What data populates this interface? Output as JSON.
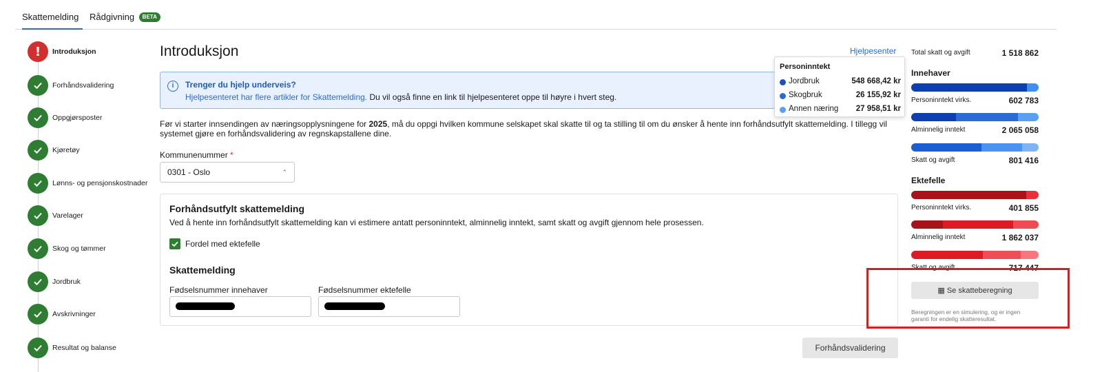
{
  "tabs": [
    {
      "label": "Skattemelding",
      "active": true
    },
    {
      "label": "Rådgivning",
      "badge": "BETA",
      "active": false
    }
  ],
  "steps": [
    {
      "label": "Introduksjon",
      "status": "error",
      "icon": "!"
    },
    {
      "label": "Forhåndsvalidering",
      "status": "done"
    },
    {
      "label": "Oppgjørsposter",
      "status": "done"
    },
    {
      "label": "Kjøretøy",
      "status": "done"
    },
    {
      "label": "Lønns- og pensjonskostnader",
      "status": "done"
    },
    {
      "label": "Varelager",
      "status": "done"
    },
    {
      "label": "Skog og tømmer",
      "status": "done"
    },
    {
      "label": "Jordbruk",
      "status": "done"
    },
    {
      "label": "Avskrivninger",
      "status": "done"
    },
    {
      "label": "Resultat og balanse",
      "status": "done"
    }
  ],
  "main": {
    "title": "Introduksjon",
    "help_link": "Hjelpesenter",
    "info": {
      "title": "Trenger du hjelp underveis?",
      "link_text": "Hjelpesenteret har flere artikler for Skattemelding.",
      "text_rest": " Du vil også finne en link til hjelpesenteret oppe til høyre i hvert steg."
    },
    "intro_pre": "Før vi starter innsendingen av næringsopplysningene for ",
    "intro_year": "2025",
    "intro_post": ", må du oppgi hvilken kommune selskapet skal skatte til og ta stilling til om du ønsker å hente inn forhåndsutfylt skattemelding. I tillegg vil systemet gjøre en forhåndsvalidering av regnskapstallene dine.",
    "kommune": {
      "label": "Kommunenummer",
      "required_mark": "*",
      "value": "0301 - Oslo"
    },
    "card": {
      "title": "Forhåndsutfylt skattemelding",
      "desc": "Ved å hente inn forhåndsutfylt skattemelding kan vi estimere antatt personinntekt, alminnelig inntekt, samt skatt og avgift gjennom hele prosessen.",
      "checkbox_label": "Fordel med ektefelle",
      "checkbox_checked": true,
      "section_title": "Skattemelding",
      "field1_label": "Fødselsnummer innehaver",
      "field2_label": "Fødselsnummer ektefelle"
    },
    "next_button": "Forhåndsvalidering"
  },
  "tooltip": {
    "title": "Personinntekt",
    "rows": [
      {
        "name": "Jordbruk",
        "value": "548 668,42 kr",
        "color": "#1c4fbf"
      },
      {
        "name": "Skogbruk",
        "value": "26 155,92 kr",
        "color": "#2a6bd6"
      },
      {
        "name": "Annen næring",
        "value": "27 958,51 kr",
        "color": "#5aa0f0"
      }
    ]
  },
  "summary": {
    "total_label": "Total skatt og avgift",
    "total_value": "1 518 862",
    "innehaver": {
      "heading": "Innehaver",
      "rows": [
        {
          "label": "Personinntekt virks.",
          "value": "602 783",
          "bar": [
            {
              "pct": 91,
              "color": "#0e3fb0"
            },
            {
              "pct": 9,
              "color": "#3f8ef0"
            }
          ]
        },
        {
          "label": "Alminnelig inntekt",
          "value": "2 065 058",
          "bar": [
            {
              "pct": 35,
              "color": "#0e3fb0"
            },
            {
              "pct": 49,
              "color": "#2a6bd6"
            },
            {
              "pct": 16,
              "color": "#5aa0f0"
            }
          ]
        },
        {
          "label": "Skatt og avgift",
          "value": "801 416",
          "bar": [
            {
              "pct": 55,
              "color": "#1c5fd1"
            },
            {
              "pct": 32,
              "color": "#4a93ee"
            },
            {
              "pct": 13,
              "color": "#7fb4f3"
            }
          ]
        }
      ]
    },
    "ektefelle": {
      "heading": "Ektefelle",
      "rows": [
        {
          "label": "Personinntekt virks.",
          "value": "401 855",
          "bar": [
            {
              "pct": 90,
              "color": "#a8131a"
            },
            {
              "pct": 10,
              "color": "#e8303a"
            }
          ]
        },
        {
          "label": "Alminnelig inntekt",
          "value": "1 862 037",
          "bar": [
            {
              "pct": 25,
              "color": "#a8131a"
            },
            {
              "pct": 55,
              "color": "#e01a22"
            },
            {
              "pct": 20,
              "color": "#f04a52"
            }
          ]
        },
        {
          "label": "Skatt og avgift",
          "value": "717 447",
          "bar": [
            {
              "pct": 56,
              "color": "#e01a22"
            },
            {
              "pct": 30,
              "color": "#ee4f56"
            },
            {
              "pct": 14,
              "color": "#f6787e"
            }
          ]
        }
      ]
    },
    "button": "Se skatteberegning",
    "note": "Beregningen er en simulering, og er ingen garanti for endelig skatteresultat."
  }
}
